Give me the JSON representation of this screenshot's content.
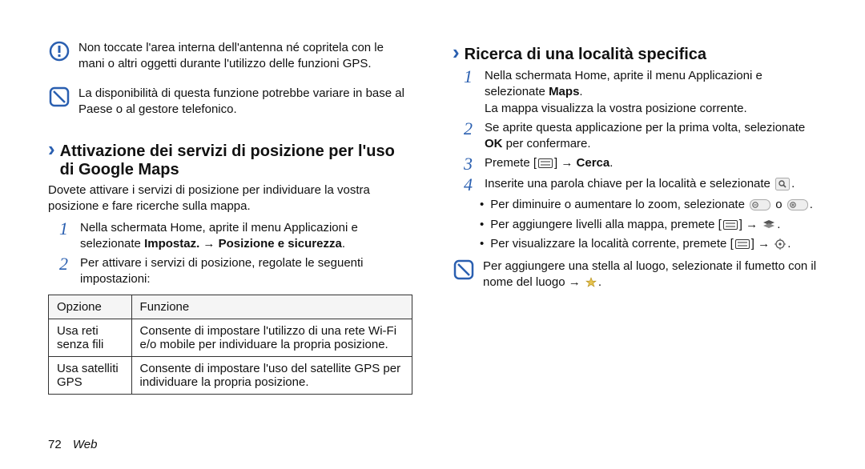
{
  "leftCol": {
    "caution": "Non toccate l'area interna dell'antenna né copritela con le mani o altri oggetti durante l'utilizzo delle funzioni GPS.",
    "note1": "La disponibilità di questa funzione potrebbe variare in base al Paese o al gestore telefonico.",
    "heading1": "Attivazione dei servizi di posizione per l'uso di Google Maps",
    "intro1": "Dovete attivare i servizi di posizione per individuare la vostra posizione e fare ricerche sulla mappa.",
    "step1_a": "Nella schermata Home, aprite il menu Applicazioni e selezionate ",
    "step1_b": "Impostaz. → Posizione e sicurezza",
    "step1_c": ".",
    "step2": "Per attivare i servizi di posizione, regolate le seguenti impostazioni:",
    "table": {
      "h1": "Opzione",
      "h2": "Funzione",
      "r1c1": "Usa reti senza fili",
      "r1c2": "Consente di impostare l'utilizzo di una rete Wi-Fi e/o mobile per individuare la propria posizione.",
      "r2c1": "Usa satelliti GPS",
      "r2c2": "Consente di impostare l'uso del satellite GPS per individuare la propria posizione."
    }
  },
  "rightCol": {
    "heading": "Ricerca di una località specifica",
    "step1_a": "Nella schermata Home, aprite il menu Applicazioni e selezionate ",
    "step1_b": "Maps",
    "step1_c": ".",
    "step1_d": "La mappa visualizza la vostra posizione corrente.",
    "step2_a": "Se aprite questa applicazione per la prima volta, selezionate ",
    "step2_b": "OK",
    "step2_c": " per confermare.",
    "step3_a": "Premete [",
    "step3_b": "] → ",
    "step3_c": "Cerca",
    "step3_d": ".",
    "step4_a": "Inserite una parola chiave per la località e selezionate ",
    "step4_b": ".",
    "bullet1_a": "Per diminuire o aumentare lo zoom, selezionate ",
    "bullet1_b": " o ",
    "bullet1_c": ".",
    "bullet2_a": "Per aggiungere livelli alla mappa, premete [",
    "bullet2_b": "] → ",
    "bullet2_c": ".",
    "bullet3_a": "Per visualizzare la località corrente, premete [",
    "bullet3_b": "] → ",
    "bullet3_c": ".",
    "tip_a": "Per aggiungere una stella al luogo, selezionate il fumetto con il nome del luogo → ",
    "tip_b": "."
  },
  "footer": {
    "page": "72",
    "section": "Web"
  }
}
